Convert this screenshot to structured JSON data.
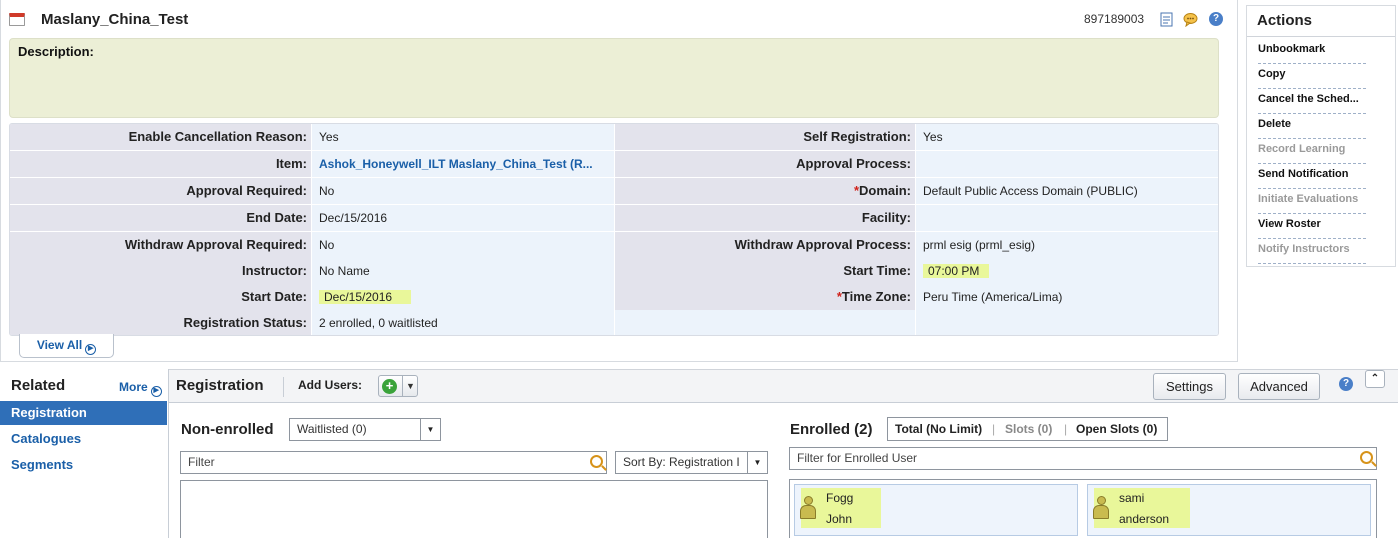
{
  "header": {
    "title": "Maslany_China_Test",
    "record_id": "897189003",
    "icons": [
      "notes-icon",
      "comments-icon",
      "help-icon"
    ]
  },
  "description": {
    "label": "Description:"
  },
  "details": {
    "left": [
      {
        "label": "Enable Cancellation Reason:",
        "value": "Yes"
      },
      {
        "label": "Item:",
        "value": "Ashok_Honeywell_ILT  Maslany_China_Test (R..."
      },
      {
        "label": "Approval Required:",
        "value": "No"
      },
      {
        "label": "End Date:",
        "value": "Dec/15/2016"
      },
      {
        "label": "Withdraw Approval Required:",
        "value": "No"
      },
      {
        "label": "Instructor:",
        "value": "No Name"
      },
      {
        "label": "Start Date:",
        "value": "Dec/15/2016"
      },
      {
        "label": "Registration Status:",
        "value": "2 enrolled, 0 waitlisted"
      }
    ],
    "right": [
      {
        "label": "Self Registration:",
        "value": "Yes"
      },
      {
        "label": "Approval Process:",
        "value": ""
      },
      {
        "label": "Domain:",
        "value": "Default Public Access Domain (PUBLIC)",
        "required": "*"
      },
      {
        "label": "Facility:",
        "value": ""
      },
      {
        "label": "Withdraw Approval Process:",
        "value": "prml esig (prml_esig)"
      },
      {
        "label": "Start Time:",
        "value": "07:00 PM"
      },
      {
        "label": "Time Zone:",
        "value": "Peru Time (America/Lima)",
        "required": "*"
      },
      {
        "label": "",
        "value": ""
      }
    ],
    "view_all_label": "View All"
  },
  "actions": {
    "title": "Actions",
    "items": [
      {
        "label": "Unbookmark",
        "enabled": true
      },
      {
        "label": "Copy",
        "enabled": true
      },
      {
        "label": "Cancel the Sched...",
        "enabled": true
      },
      {
        "label": "Delete",
        "enabled": true
      },
      {
        "label": "Record Learning",
        "enabled": false
      },
      {
        "label": "Send Notification",
        "enabled": true
      },
      {
        "label": "Initiate Evaluations",
        "enabled": false
      },
      {
        "label": "View Roster",
        "enabled": true
      },
      {
        "label": "Notify Instructors",
        "enabled": false
      }
    ]
  },
  "related": {
    "title": "Related",
    "more_label": "More",
    "items": [
      {
        "label": "Registration",
        "active": true
      },
      {
        "label": "Catalogues",
        "active": false
      },
      {
        "label": "Segments",
        "active": false
      }
    ]
  },
  "registration": {
    "title": "Registration",
    "add_users_label": "Add Users:",
    "settings_label": "Settings",
    "advanced_label": "Advanced",
    "non_enrolled": {
      "title": "Non-enrolled",
      "filter_select": "Waitlisted (0)",
      "filter_placeholder": "Filter",
      "sort_select": "Sort By: Registration I"
    },
    "enrolled": {
      "title": "Enrolled (2)",
      "slots": {
        "total": "Total (No Limit)",
        "slots": "Slots (0)",
        "open": "Open Slots (0)"
      },
      "filter_placeholder": "Filter for Enrolled User",
      "users": [
        {
          "last": "Fogg",
          "first": "John"
        },
        {
          "last": "sami",
          "first": "anderson"
        }
      ]
    }
  },
  "colors": {
    "link_blue": "#1a5fa8",
    "active_tab": "#2f6fb8",
    "highlight_yellow": "#e9f79a",
    "description_bg": "#ecefd6"
  }
}
